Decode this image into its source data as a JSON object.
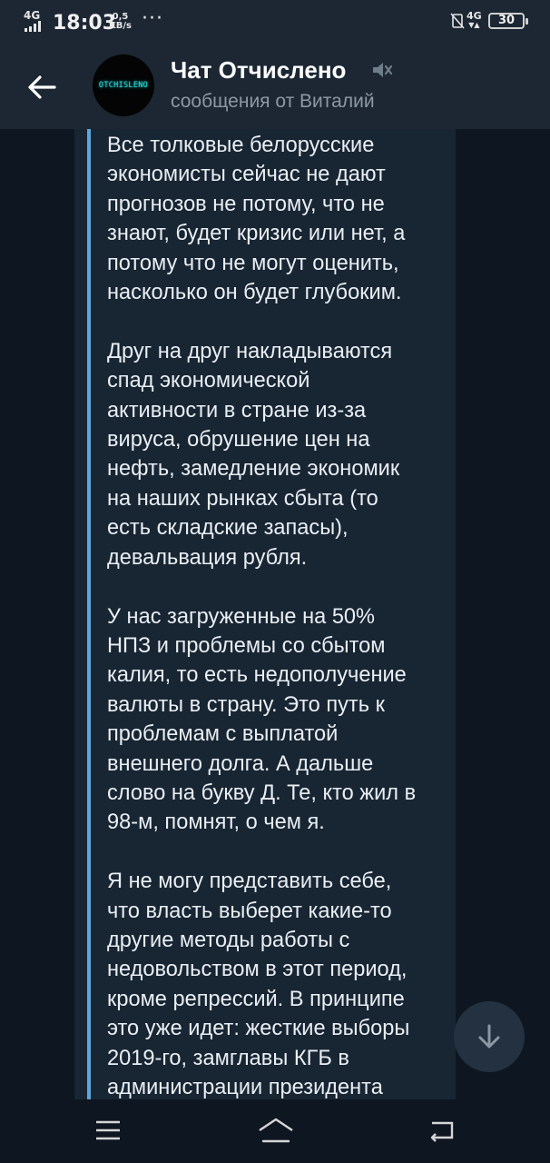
{
  "status_bar": {
    "network": "4G",
    "time": "18:03",
    "speed_value": "0,5",
    "speed_unit": "KB/s",
    "more": "···",
    "network2": "4G",
    "battery": "30"
  },
  "header": {
    "title": "Чат Отчислено",
    "subtitle": "сообщения от Виталий",
    "avatar_text": "OTCHISLENO"
  },
  "message": {
    "text": "Все толковые белорусские\nэкономисты сейчас не дают\nпрогнозов не потому, что не\nзнают, будет кризис или нет, а\nпотому что не могут оценить,\nнасколько он будет глубоким.\n\nДруг на друг накладываются\nспад экономической\nактивности в стране из-за\nвируса, обрушение цен на\nнефть, замедление экономик\nна наших рынках сбыта (то\nесть складские запасы),\nдевальвация рубля.\n\nУ нас загруженные на 50%\nНПЗ и проблемы со сбытом\nкалия, то есть недополучение\nвалюты в страну. Это путь к\nпроблемам с выплатой\nвнешнего долга. А дальше\nслово на букву Д. Те, кто жил в\n98-м, помнят, о чем я.\n\nЯ не могу представить себе,\nчто власть выберет какие-то\nдругие методы работы с\nнедовольством в этот период,\nкроме репрессий. В принципе\nэто уже идет: жесткие выборы\n2019-го, замглавы КГБ в\nадминистрации президента"
  },
  "colors": {
    "background": "#0e1621",
    "header": "#1c2733",
    "bubble": "#182533",
    "quote_accent": "#5fa6da",
    "subtitle": "#8c99a5"
  },
  "icons": {
    "back": "arrow-left-icon",
    "mute": "speaker-muted-icon",
    "scroll": "arrow-down-icon",
    "nav_menu": "menu-icon",
    "nav_home": "home-icon",
    "nav_back": "return-icon"
  }
}
